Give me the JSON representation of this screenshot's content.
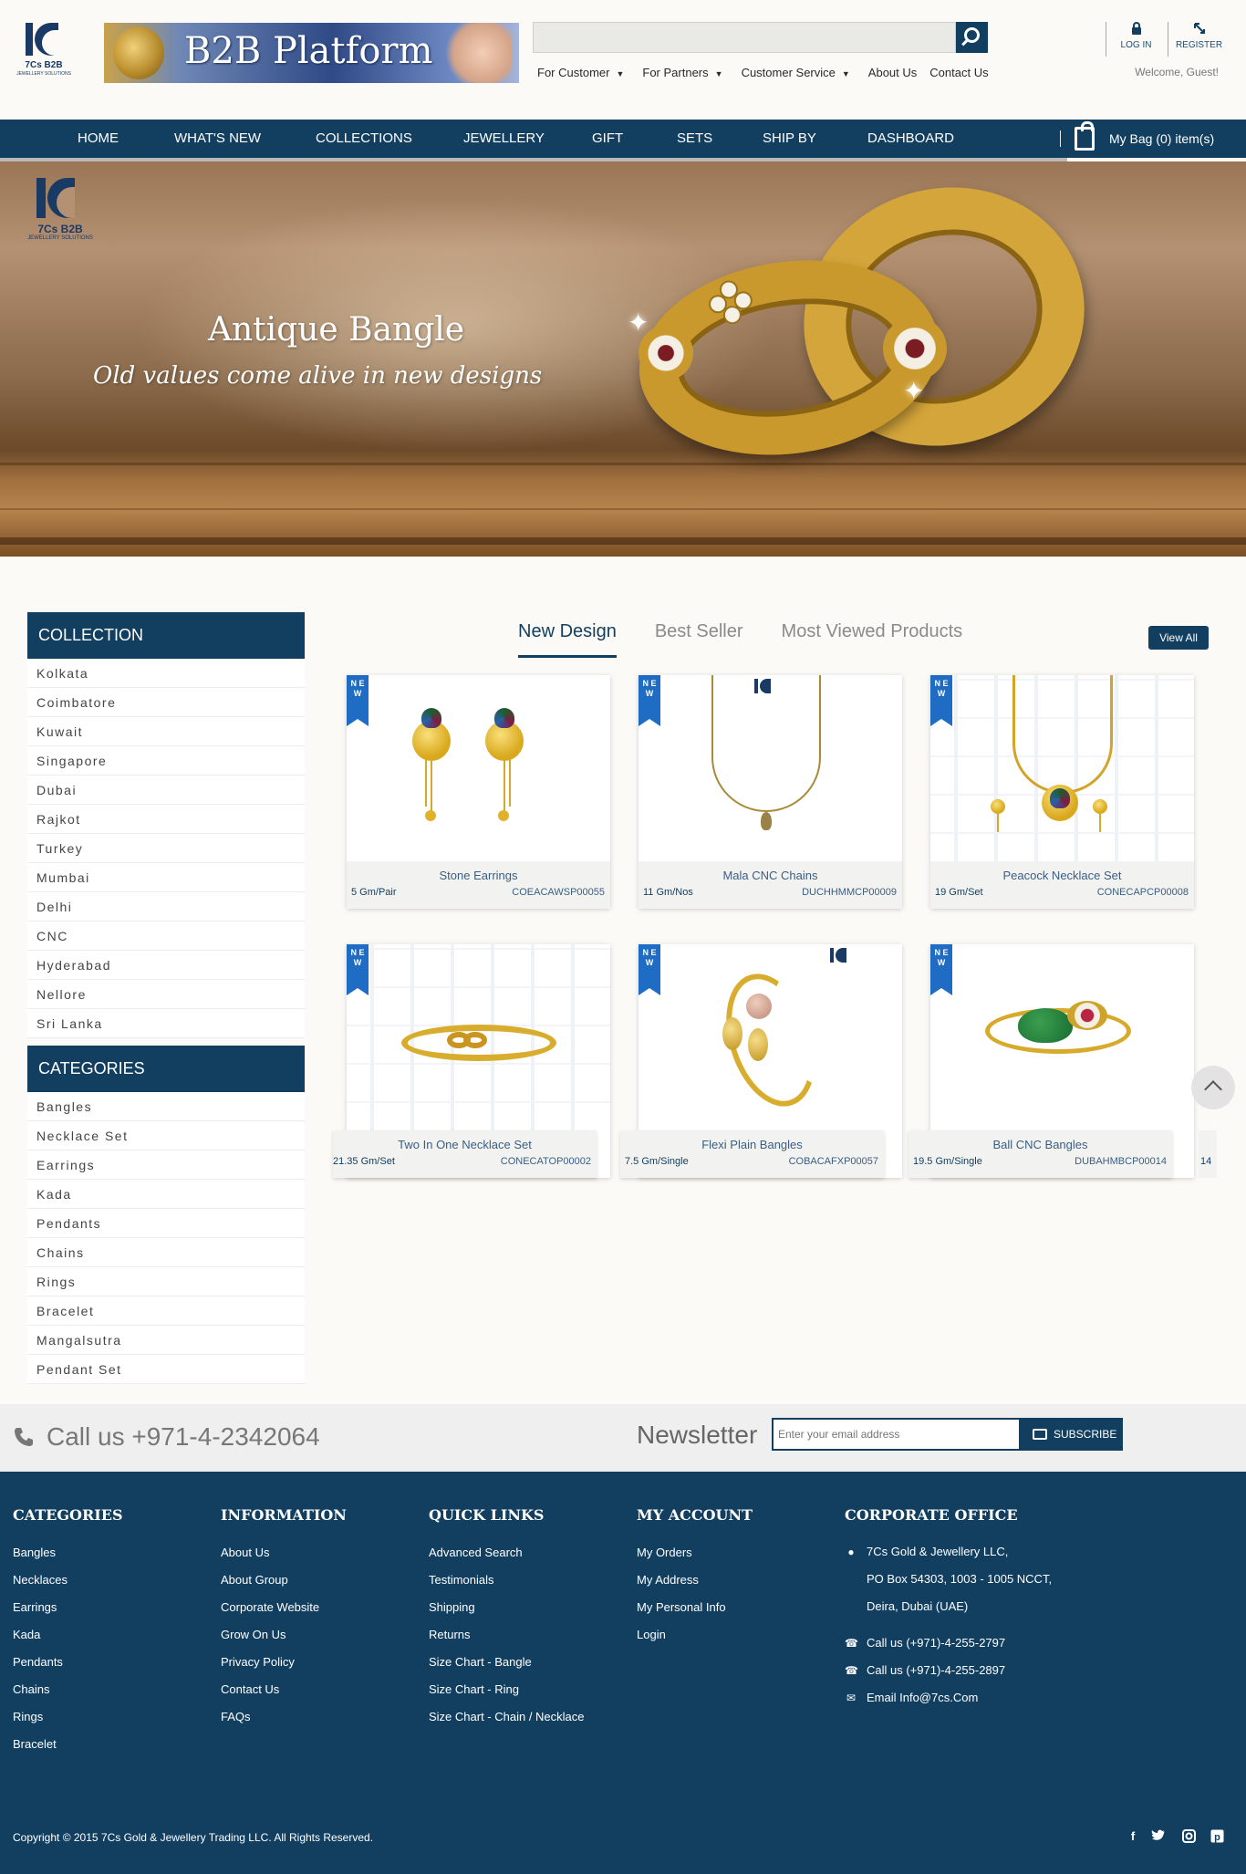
{
  "header": {
    "logo_text": "7Cs B2B",
    "logo_sub": "JEWELLERY SOLUTIONS",
    "banner_text": "B2B Platform",
    "search": {
      "value": "",
      "placeholder": ""
    },
    "top_nav": [
      {
        "label": "For Customer",
        "caret": "▼"
      },
      {
        "label": "For Partners",
        "caret": "▼"
      },
      {
        "label": "Customer Service",
        "caret": "▼"
      },
      {
        "label": "About Us",
        "caret": ""
      },
      {
        "label": "Contact Us",
        "caret": ""
      }
    ],
    "login_label": "LOG IN",
    "register_label": "REGISTER",
    "welcome": "Welcome, Guest!"
  },
  "main_nav": {
    "items": [
      "HOME",
      "WHAT'S NEW",
      "COLLECTIONS",
      "JEWELLERY",
      "GIFT",
      "SETS",
      "SHIP BY",
      "DASHBOARD"
    ],
    "bag_label": "My Bag (0) item(s)"
  },
  "hero": {
    "logo_text": "7Cs B2B",
    "logo_sub": "JEWELLERY SOLUTIONS",
    "title": "Antique Bangle",
    "subtitle": "Old values come alive in new designs"
  },
  "sidebar": {
    "collection_title": "COLLECTION",
    "collections": [
      "Kolkata",
      "Coimbatore",
      "Kuwait",
      "Singapore",
      "Dubai",
      "Rajkot",
      "Turkey",
      "Mumbai",
      "Delhi",
      "CNC",
      "Hyderabad",
      "Nellore",
      "Sri Lanka"
    ],
    "categories_title": "CATEGORIES",
    "categories": [
      "Bangles",
      "Necklace Set",
      "Earrings",
      "Kada",
      "Pendants",
      "Chains",
      "Rings",
      "Bracelet",
      "Mangalsutra",
      "Pendant Set"
    ]
  },
  "products": {
    "tabs": [
      "New Design",
      "Best Seller",
      "Most Viewed Products"
    ],
    "view_all": "View All",
    "badge": "N E W",
    "items": [
      {
        "name": "Stone Earrings",
        "weight": "5 Gm/Pair",
        "code": "COEACAWSP00055"
      },
      {
        "name": "Mala CNC Chains",
        "weight": "11 Gm/Nos",
        "code": "DUCHHMMCP00009"
      },
      {
        "name": "Peacock Necklace Set",
        "weight": "19 Gm/Set",
        "code": "CONECAPCP00008"
      },
      {
        "name": "Two In One Necklace Set",
        "weight": "21.35 Gm/Set",
        "code": "CONECATOP00002"
      },
      {
        "name": "Flexi Plain Bangles",
        "weight": "7.5 Gm/Single",
        "code": "COBACAFXP00057"
      },
      {
        "name": "Ball CNC Bangles",
        "weight": "19.5 Gm/Single",
        "code": "DUBAHMBCP00014"
      }
    ],
    "partial_weight": "14"
  },
  "callbar": {
    "call_text": "Call us +971-4-2342064",
    "newsletter_title": "Newsletter",
    "email": {
      "value": "",
      "placeholder": "Enter your email address"
    },
    "subscribe": "SUBSCRIBE"
  },
  "footer": {
    "categories": {
      "title": "CATEGORIES",
      "links": [
        "Bangles",
        "Necklaces",
        "Earrings",
        "Kada",
        "Pendants",
        "Chains",
        "Rings",
        "Bracelet"
      ]
    },
    "information": {
      "title": "INFORMATION",
      "links": [
        "About Us",
        "About Group",
        "Corporate Website",
        "Grow On Us",
        "Privacy Policy",
        "Contact Us",
        "FAQs"
      ]
    },
    "quick_links": {
      "title": "QUICK LINKS",
      "links": [
        "Advanced Search",
        "Testimonials",
        "Shipping",
        "Returns",
        "Size Chart - Bangle",
        "Size Chart - Ring",
        "Size Chart - Chain / Necklace"
      ]
    },
    "my_account": {
      "title": "MY ACCOUNT",
      "links": [
        "My Orders",
        "My Address",
        "My Personal Info",
        "Login"
      ]
    },
    "corporate": {
      "title": "CORPORATE OFFICE",
      "address": [
        "7Cs Gold & Jewellery LLC,",
        "PO Box 54303, 1003 - 1005 NCCT,",
        "Deira, Dubai (UAE)"
      ],
      "phone1": "Call us (+971)-4-255-2797",
      "phone2": "Call us (+971)-4-255-2897",
      "email": "Email Info@7cs.Com"
    },
    "copyright": "Copyright © 2015 7Cs Gold & Jewellery Trading LLC. All Rights Reserved.",
    "social": [
      "facebook",
      "twitter",
      "instagram",
      "pinterest"
    ]
  },
  "colors": {
    "brand": "#123f60",
    "badge": "#1e6cc4",
    "background": "#fbfaf6"
  }
}
